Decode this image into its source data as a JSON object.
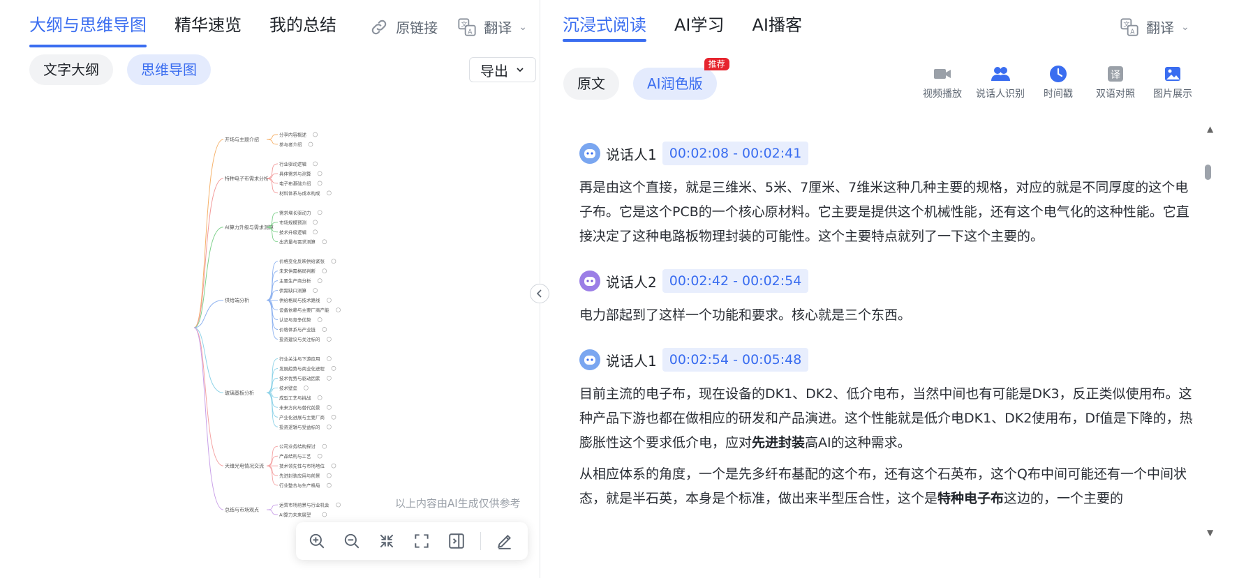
{
  "left": {
    "tabs": [
      {
        "label": "大纲与思维导图"
      },
      {
        "label": "精华速览"
      },
      {
        "label": "我的总结"
      }
    ],
    "actions": {
      "source_link": "原链接",
      "translate": "翻译"
    },
    "view_pills": [
      {
        "label": "文字大纲"
      },
      {
        "label": "思维导图"
      }
    ],
    "export_label": "导出",
    "disclaimer": "以上内容由AI生成仅供参考",
    "mindmap": {
      "branches": [
        {
          "title": "开场与主题介绍",
          "children": [
            "分享内容概述",
            "参与者介绍"
          ]
        },
        {
          "title": "特种电子布需求分析",
          "children": [
            "行业驱动逻辑",
            "具体需求与测算",
            "电子布基础介绍",
            "材料体系与成本构成"
          ]
        },
        {
          "title": "AI算力升级与需求测算",
          "children": [
            "需求增长驱动力",
            "市场规模预测",
            "技术升级逻辑",
            "出货量与需求测算"
          ]
        },
        {
          "title": "供给端分析",
          "children": [
            "价格变化反映供给紧张",
            "未来供需格局判断",
            "主要生产商分析",
            "供需缺口测算",
            "供给格局与技术路线",
            "设备依赖与主要厂商产能",
            "认证与竞争优势",
            "价格体系与产业链",
            "投资建议与关注标的"
          ]
        },
        {
          "title": "玻璃基板分析",
          "children": [
            "行业关注与下游应用",
            "发展趋势与商业化进程",
            "技术优势与驱动因素",
            "技术壁垒",
            "成型工艺与挑战",
            "未来方向与替代前景",
            "产业化进展与主要厂商",
            "投资逻辑与受益标的"
          ]
        },
        {
          "title": "天维光电情况交流",
          "children": [
            "公司业务结构探讨",
            "产品结构与工艺",
            "技术领先性与市场地位",
            "先进封装应用与前景",
            "行业整合与生产格局"
          ]
        },
        {
          "title": "总结与市场观点",
          "children": [
            "运营市场前景与行业机会",
            "AI算力未来展望"
          ]
        }
      ]
    }
  },
  "right": {
    "tabs": [
      {
        "label": "沉浸式阅读"
      },
      {
        "label": "AI学习"
      },
      {
        "label": "AI播客"
      }
    ],
    "translate": "翻译",
    "view_pills": [
      {
        "label": "原文"
      },
      {
        "label": "AI润色版"
      }
    ],
    "badge": "推荐",
    "features": [
      {
        "label": "视频播放",
        "icon": "video-icon"
      },
      {
        "label": "说话人识别",
        "icon": "speakers-icon"
      },
      {
        "label": "时间戳",
        "icon": "clock-icon"
      },
      {
        "label": "双语对照",
        "icon": "translate-icon"
      },
      {
        "label": "图片展示",
        "icon": "image-icon"
      }
    ],
    "segments": [
      {
        "speaker": "说话人1",
        "time": "00:02:08 - 00:02:41",
        "avatar_color": "#7aa6f0",
        "paras": [
          "再是由这个直接，就是三维米、5米、7厘米、7维米这种几种主要的规格，对应的就是不同厚度的这个电子布。它是这个PCB的一个核心原材料。它主要是提供这个机械性能，还有这个电气化的这种性能。它直接决定了这种电路板物理封装的可能性。这个主要特点就列了一下这个主要的。"
        ]
      },
      {
        "speaker": "说话人2",
        "time": "00:02:42 - 00:02:54",
        "avatar_color": "#9b7ee6",
        "paras": [
          "电力部起到了这样一个功能和要求。核心就是三个东西。"
        ]
      },
      {
        "speaker": "说话人1",
        "time": "00:02:54 - 00:05:48",
        "avatar_color": "#7aa6f0",
        "paras": [
          "目前主流的电子布，现在设备的DK1、DK2、低介电布，当然中间也有可能是DK3，反正类似使用布。这种产品下游也都在做相应的研发和产品演进。这个性能就是低介电DK1、DK2使用布，Df值是下降的，热膨胀性这个要求低介电，应对",
          "从相应体系的角度，一个是先多纤布基配的这个布，还有这个石英布，这个Q布中间可能还有一个中间状态，就是半石英，本身是个标准，做出来半型压合性，这个是"
        ],
        "bold_1": "先进封装",
        "tail_1": "高AI的这种需求。",
        "bold_2": "特种电子布",
        "tail_2": "这边的，一个主要的"
      }
    ]
  }
}
